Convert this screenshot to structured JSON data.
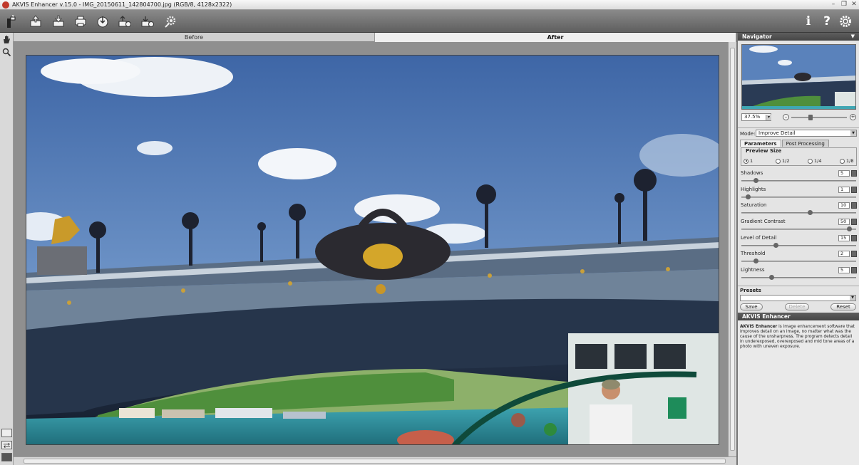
{
  "window": {
    "title": "AKVIS Enhancer v.15.0 - IMG_20150611_142804700.jpg (RGB/8, 4128x2322)",
    "minimize": "–",
    "maximize": "❐",
    "close": "✕"
  },
  "toolbar": {
    "left_icons": [
      "magic-wand-icon",
      "open-file-icon",
      "save-file-icon",
      "print-icon",
      "import-icon",
      "export-icon",
      "batch-icon",
      "plugin-settings-icon"
    ],
    "right_icons": [
      "info-icon",
      "help-icon",
      "preferences-icon"
    ],
    "info_label": "i",
    "help_label": "?"
  },
  "tabs": {
    "before": "Before",
    "after": "After"
  },
  "navigator": {
    "title": "Navigator",
    "zoom": "37.5%",
    "zoom_out": "–",
    "zoom_in": "+"
  },
  "mode": {
    "label": "Mode:",
    "value": "Improve Detail"
  },
  "panel_tabs": {
    "parameters": "Parameters",
    "post_processing": "Post Processing"
  },
  "preview_size": {
    "title": "Preview Size",
    "options": [
      "1",
      "1/2",
      "1/4",
      "1/8"
    ],
    "selected": "1"
  },
  "parameters": [
    {
      "label": "Shadows",
      "value": "5",
      "level": 0.12
    },
    {
      "label": "Highlights",
      "value": "1",
      "level": 0.05
    },
    {
      "label": "Saturation",
      "value": "10",
      "level": 0.6
    },
    {
      "label": "Gradient Contrast",
      "value": "50",
      "level": 0.95
    },
    {
      "label": "Level of Detail",
      "value": "15",
      "level": 0.3
    },
    {
      "label": "Threshold",
      "value": "2",
      "level": 0.12
    },
    {
      "label": "Lightness",
      "value": "5",
      "level": 0.26
    }
  ],
  "presets": {
    "title": "Presets",
    "save": "Save",
    "delete": "Delete",
    "reset": "Reset"
  },
  "info": {
    "title": "AKVIS Enhancer",
    "bold": "AKVIS Enhancer",
    "text": " is image enhancement software that improves detail on an image, no matter what was the cause of the unsharpness. The program detects detail in underexposed, overexposed and mid tone areas of a photo with uneven exposure."
  },
  "colors": {
    "sky": "#5a82bb",
    "bridge": "#3c4f66",
    "water": "#2f8f9f",
    "panel": "#e4e4e4",
    "toolbar": "#6d6d6d"
  }
}
